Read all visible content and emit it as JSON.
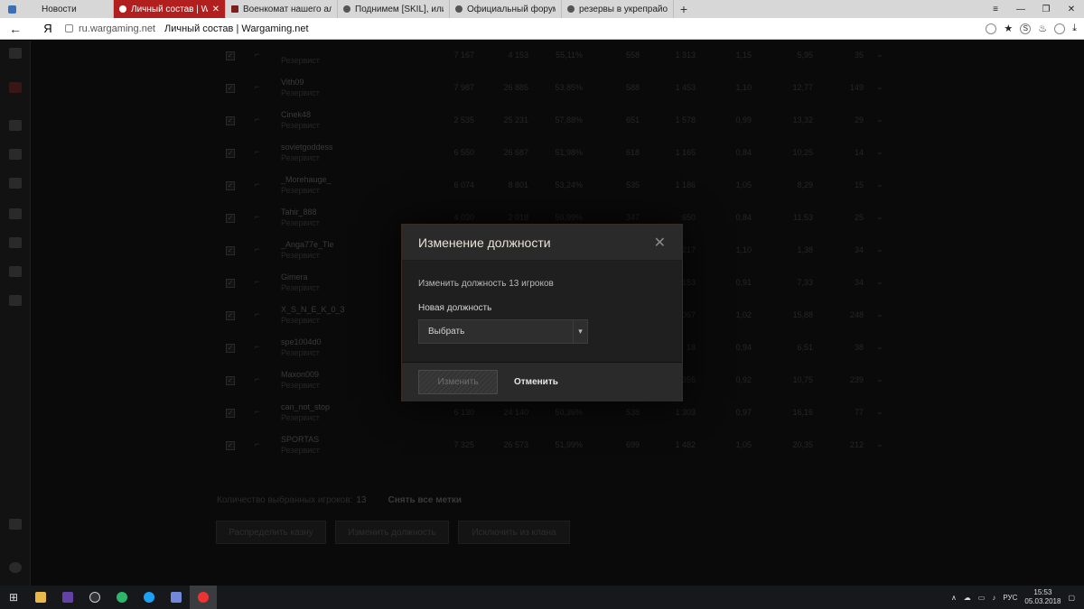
{
  "browser": {
    "tabs": [
      {
        "title": "Новости",
        "active": false
      },
      {
        "title": "Личный состав | Wargam",
        "active": true
      },
      {
        "title": "Военкомат нашего альянс",
        "active": false
      },
      {
        "title": "Поднимем [SKIL], или Как н",
        "active": false
      },
      {
        "title": "Официальный форум игры",
        "active": false
      },
      {
        "title": "резервы в укрепрайоне - Я",
        "active": false
      }
    ],
    "new_tab": "+",
    "address": {
      "domain": "ru.wargaming.net",
      "page_title": "Личный состав | Wargaming.net"
    },
    "ya_button": "Я"
  },
  "table": {
    "rows": [
      {
        "nick": "",
        "role": "Резервист",
        "v1": "7 167",
        "v2": "4 153",
        "v3": "55,11%",
        "v4": "558",
        "v5": "1 313",
        "v6": "1,15",
        "v7": "5,95",
        "v8": "35"
      },
      {
        "nick": "Vith09",
        "role": "Резервист",
        "v1": "7 987",
        "v2": "26 885",
        "v3": "53,85%",
        "v4": "588",
        "v5": "1 453",
        "v6": "1,10",
        "v7": "12,77",
        "v8": "149"
      },
      {
        "nick": "Cinek48",
        "role": "Резервист",
        "v1": "2 535",
        "v2": "25 231",
        "v3": "57,88%",
        "v4": "651",
        "v5": "1 578",
        "v6": "0,99",
        "v7": "13,32",
        "v8": "29"
      },
      {
        "nick": "sovietgoddess",
        "role": "Резервист",
        "v1": "6 550",
        "v2": "26 687",
        "v3": "51,98%",
        "v4": "618",
        "v5": "1 165",
        "v6": "0,84",
        "v7": "10,25",
        "v8": "14"
      },
      {
        "nick": "_Morehauge_",
        "role": "Резервист",
        "v1": "6 074",
        "v2": "8 801",
        "v3": "53,24%",
        "v4": "535",
        "v5": "1 186",
        "v6": "1,05",
        "v7": "8,29",
        "v8": "15"
      },
      {
        "nick": "Tahir_888",
        "role": "Резервист",
        "v1": "4 030",
        "v2": "2 018",
        "v3": "50,99%",
        "v4": "347",
        "v5": "650",
        "v6": "0,84",
        "v7": "11,53",
        "v8": "25"
      },
      {
        "nick": "_Anga77e_Tle",
        "role": "Резервист",
        "v1": "",
        "v2": "",
        "v3": "",
        "v4": "",
        "v5": "217",
        "v6": "1,10",
        "v7": "1,38",
        "v8": "34"
      },
      {
        "nick": "Gimera",
        "role": "Резервист",
        "v1": "",
        "v2": "",
        "v3": "",
        "v4": "",
        "v5": "153",
        "v6": "0,91",
        "v7": "7,33",
        "v8": "34"
      },
      {
        "nick": "X_S_N_E_K_0_3",
        "role": "Резервист",
        "v1": "",
        "v2": "",
        "v3": "",
        "v4": "",
        "v5": "067",
        "v6": "1,02",
        "v7": "15,88",
        "v8": "248"
      },
      {
        "nick": "spe1004d0",
        "role": "Резервист",
        "v1": "",
        "v2": "",
        "v3": "",
        "v4": "",
        "v5": "18",
        "v6": "0,94",
        "v7": "6,51",
        "v8": "38"
      },
      {
        "nick": "Maxon009",
        "role": "Резервист",
        "v1": "",
        "v2": "",
        "v3": "",
        "v4": "",
        "v5": "355",
        "v6": "0,92",
        "v7": "10,75",
        "v8": "239"
      },
      {
        "nick": "can_not_stop",
        "role": "Резервист",
        "v1": "6 130",
        "v2": "24 140",
        "v3": "50,36%",
        "v4": "538",
        "v5": "1 303",
        "v6": "0,97",
        "v7": "16,16",
        "v8": "77"
      },
      {
        "nick": "SPORTAS",
        "role": "Резервист",
        "v1": "7 325",
        "v2": "26 573",
        "v3": "51,99%",
        "v4": "699",
        "v5": "1 482",
        "v6": "1,05",
        "v7": "20,35",
        "v8": "212"
      }
    ]
  },
  "footer": {
    "selected_label": "Количество выбранных игроков:",
    "selected_count": "13",
    "clear_label": "Снять все метки",
    "buttons": [
      "Распределить казну",
      "Изменить должность",
      "Исключить из клана"
    ]
  },
  "modal": {
    "title": "Изменение должности",
    "close": "✕",
    "description": "Изменить должность 13 игроков",
    "field_label": "Новая должность",
    "select_value": "Выбрать",
    "apply_label": "Изменить",
    "cancel_label": "Отменить"
  },
  "taskbar": {
    "lang": "РУС",
    "time": "15:53",
    "date": "05.03.2018"
  }
}
